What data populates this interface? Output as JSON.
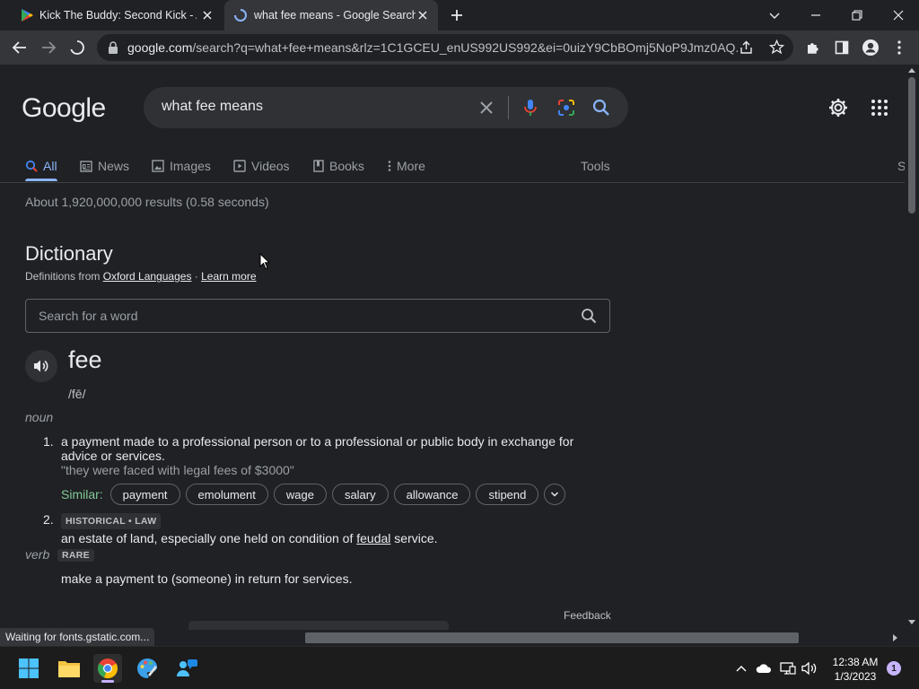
{
  "browser": {
    "tabs": [
      {
        "title": "Kick The Buddy: Second Kick - Ap",
        "active": false
      },
      {
        "title": "what fee means - Google Search",
        "active": true
      }
    ],
    "address": {
      "host": "google.com",
      "path": "/search?q=what+fee+means&rlz=1C1GCEU_enUS992US992&ei=0uizY9CbBOmj5NoP9Jmz0AQ..."
    },
    "status_text": "Waiting for fonts.gstatic.com..."
  },
  "search": {
    "logo": "Google",
    "query": "what fee means",
    "tabs": [
      {
        "label": "All",
        "icon": "search-icon",
        "active": true
      },
      {
        "label": "News",
        "icon": "news-icon"
      },
      {
        "label": "Images",
        "icon": "image-icon"
      },
      {
        "label": "Videos",
        "icon": "video-icon"
      },
      {
        "label": "Books",
        "icon": "book-icon"
      },
      {
        "label": "More",
        "icon": "more-vert-icon"
      }
    ],
    "tools_label": "Tools",
    "edge_letter": "S",
    "result_stats": "About 1,920,000,000 results (0.58 seconds)"
  },
  "dictionary": {
    "heading": "Dictionary",
    "source_prefix": "Definitions from ",
    "source_link": "Oxford Languages",
    "separator": " · ",
    "learn_more": "Learn more",
    "word_search_placeholder": "Search for a word",
    "word": "fee",
    "phonetic": "/fē/",
    "noun": {
      "pos": "noun",
      "def1": {
        "num": "1.",
        "text": "a payment made to a professional person or to a professional or public body in exchange for advice or services.",
        "example": "\"they were faced with legal fees of $3000\""
      },
      "similar_label": "Similar:",
      "similar": [
        "payment",
        "emolument",
        "wage",
        "salary",
        "allowance",
        "stipend"
      ],
      "def2": {
        "num": "2.",
        "tag": "HISTORICAL • LAW",
        "text_before": "an estate of land, especially one held on condition of ",
        "link": "feudal",
        "text_after": " service."
      }
    },
    "verb": {
      "pos": "verb",
      "tag": "RARE",
      "text": "make a payment to (someone) in return for services."
    },
    "feedback": "Feedback"
  },
  "taskbar": {
    "time": "12:38 AM",
    "date": "1/3/2023",
    "notification_count": "1"
  },
  "colors": {
    "accent": "#8ab4f8",
    "similar_green": "#81c995",
    "page_bg": "#202124"
  }
}
